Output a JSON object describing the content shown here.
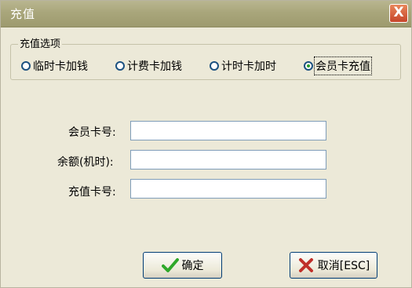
{
  "window": {
    "title": "充值",
    "close_label": "X"
  },
  "options_group": {
    "legend": "充值选项",
    "items": [
      {
        "label": "临时卡加钱",
        "selected": false
      },
      {
        "label": "计费卡加钱",
        "selected": false
      },
      {
        "label": "计时卡加时",
        "selected": false
      },
      {
        "label": "会员卡充值",
        "selected": true
      }
    ]
  },
  "form": {
    "member_card_label": "会员卡号:",
    "member_card_value": "",
    "balance_label": "余额(机时):",
    "balance_value": "",
    "recharge_card_label": "充值卡号:",
    "recharge_card_value": ""
  },
  "buttons": {
    "confirm_label": "确定",
    "cancel_label": "取消[ESC]"
  },
  "colors": {
    "titlebar": "#a9a67b",
    "dialog_bg": "#ece9d8",
    "confirm_icon": "#2fa82a",
    "cancel_icon": "#c0302a"
  }
}
